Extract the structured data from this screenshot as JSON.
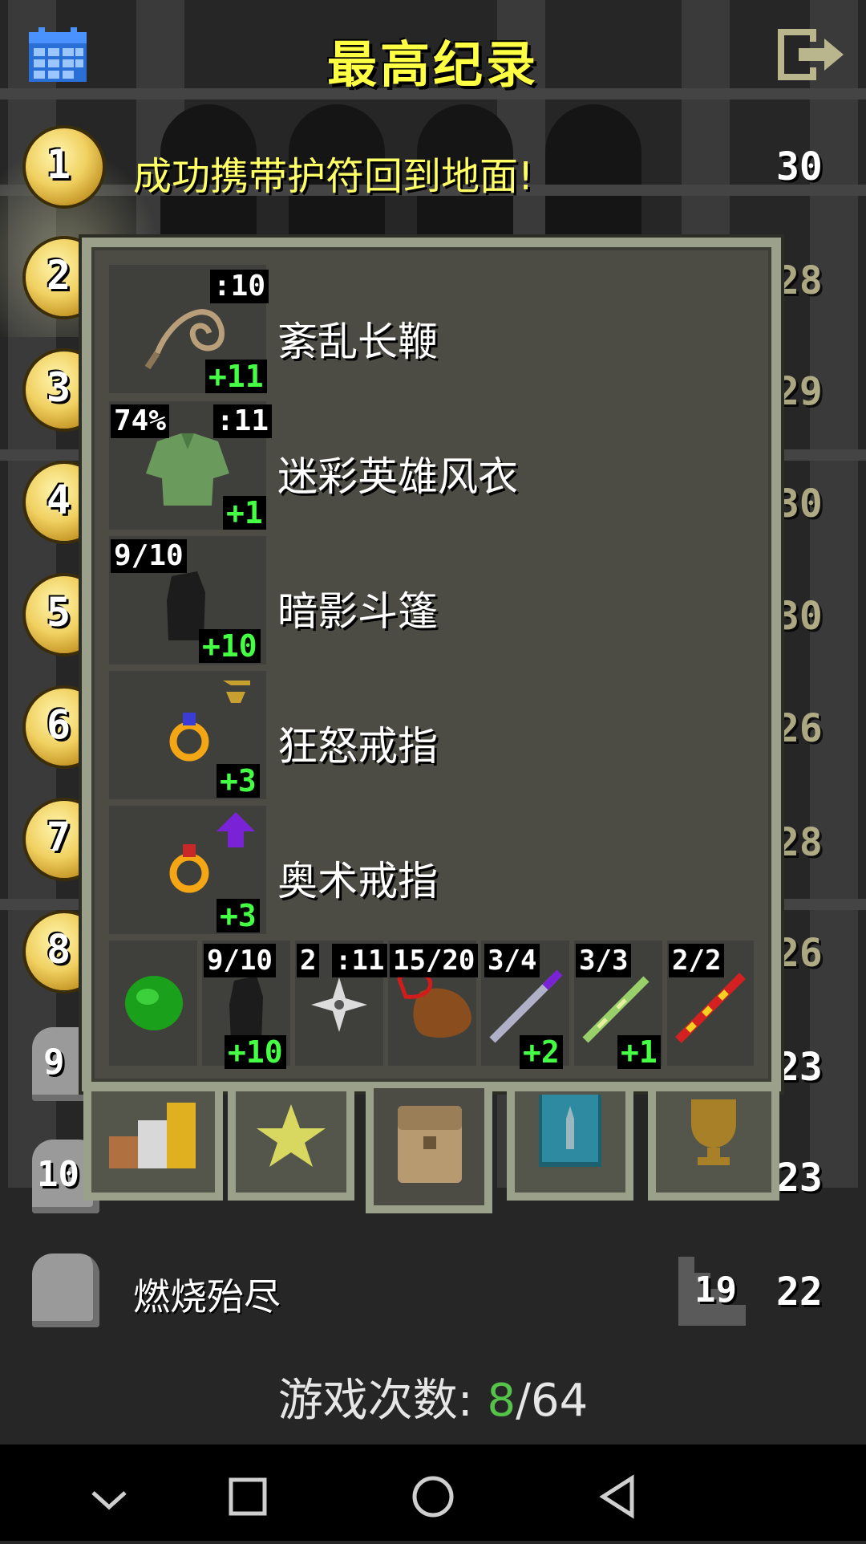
{
  "header": {
    "title": "最高纪录",
    "calendar_icon": "calendar-icon",
    "exit_icon": "exit-icon"
  },
  "rankings": [
    {
      "rank": "1",
      "text": "成功携带护符回到地面!",
      "score": "30"
    },
    {
      "rank": "2",
      "score": "28"
    },
    {
      "rank": "3",
      "score": "29"
    },
    {
      "rank": "4",
      "score": "30"
    },
    {
      "rank": "5",
      "score": "30"
    },
    {
      "rank": "6",
      "score": "26"
    },
    {
      "rank": "7",
      "score": "28"
    },
    {
      "rank": "8",
      "score": "26"
    },
    {
      "rank": "9",
      "score": "23"
    },
    {
      "rank": "10",
      "score": "23"
    }
  ],
  "items": [
    {
      "name": "紊乱长鞭",
      "top_right": ":10",
      "bottom": "+11",
      "icon": "whip-icon"
    },
    {
      "name": "迷彩英雄风衣",
      "top_left": "74%",
      "top_right": ":11",
      "bottom": "+1",
      "icon": "cloak-icon"
    },
    {
      "name": "暗影斗篷",
      "top_left": "9/10",
      "bottom": "+10",
      "icon": "shadow-cloak-icon"
    },
    {
      "name": "狂怒戒指",
      "bottom": "+3",
      "icon": "ring-icon"
    },
    {
      "name": "奥术戒指",
      "bottom": "+3",
      "icon": "ring-icon"
    }
  ],
  "quickslots": [
    {
      "icon": "seed-icon"
    },
    {
      "top": "9/10",
      "bottom": "+10",
      "icon": "cloak-icon"
    },
    {
      "top_left": "2",
      "top_right": ":11",
      "icon": "shuriken-icon"
    },
    {
      "top": "15/20",
      "icon": "bag-icon"
    },
    {
      "top": "3/4",
      "bottom": "+2",
      "icon": "wand-icon"
    },
    {
      "top": "3/3",
      "bottom": "+1",
      "icon": "wand-icon"
    },
    {
      "top": "2/2",
      "icon": "wand-icon"
    }
  ],
  "tabs": [
    {
      "name": "stats",
      "icon": "stats-icon"
    },
    {
      "name": "badges",
      "icon": "star-icon"
    },
    {
      "name": "items",
      "icon": "backpack-icon"
    },
    {
      "name": "journal",
      "icon": "book-icon"
    },
    {
      "name": "trophy",
      "icon": "trophy-icon"
    }
  ],
  "last_entry": {
    "name": "燃烧殆尽",
    "depth": "19",
    "score": "22"
  },
  "footer": {
    "label": "游戏次数:",
    "current": "8",
    "sep": "/",
    "total": "64"
  },
  "colors": {
    "title": "#ffff44",
    "green": "#44ff44",
    "panel": "#4c4c45",
    "frame": "#9aa089"
  }
}
